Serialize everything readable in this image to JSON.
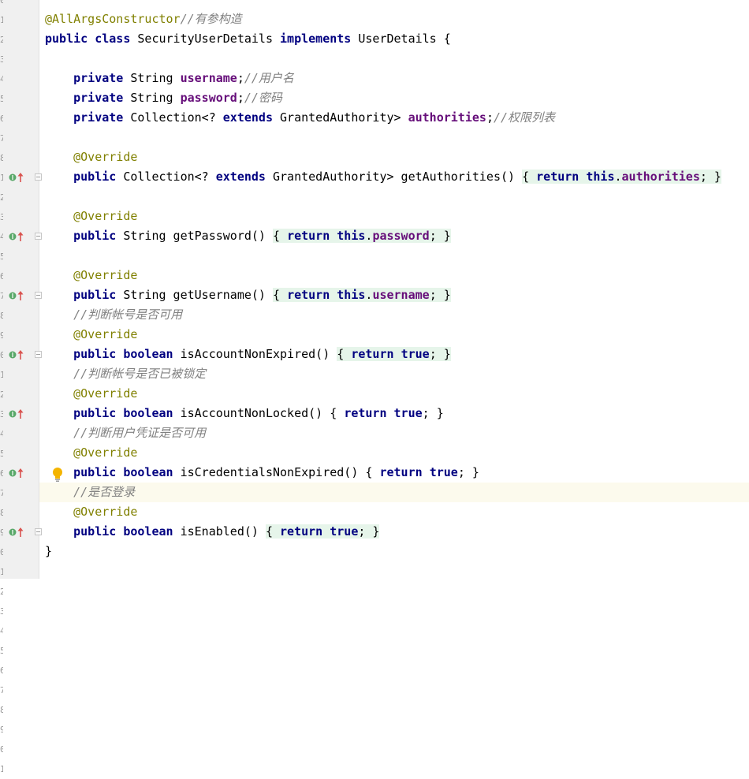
{
  "editor": {
    "line_numbers": [
      "0",
      "1",
      "2",
      "3",
      "4",
      "5",
      "6",
      "7",
      "8",
      "1",
      "2",
      "3",
      "4",
      "5",
      "6",
      "7",
      "8",
      "9",
      "0",
      "1",
      "2",
      "3",
      "4",
      "5",
      "6",
      "7",
      "8",
      "9",
      "0",
      "1",
      "2",
      "3",
      "4",
      "5",
      "6",
      "7",
      "8",
      "9",
      "0",
      "1"
    ],
    "lines": [
      [
        {
          "t": "@AllArgsConstructor",
          "c": "ann"
        },
        {
          "t": "//有参构造",
          "c": "cmt"
        }
      ],
      [
        {
          "t": "public",
          "c": "kw"
        },
        {
          "t": " "
        },
        {
          "t": "class",
          "c": "kw"
        },
        {
          "t": " SecurityUserDetails "
        },
        {
          "t": "implements",
          "c": "kw"
        },
        {
          "t": " UserDetails {"
        }
      ],
      [],
      [
        {
          "t": "    "
        },
        {
          "t": "private",
          "c": "kw"
        },
        {
          "t": " String "
        },
        {
          "t": "username",
          "c": "fld"
        },
        {
          "t": ";"
        },
        {
          "t": "//用户名",
          "c": "cmt"
        }
      ],
      [
        {
          "t": "    "
        },
        {
          "t": "private",
          "c": "kw"
        },
        {
          "t": " String "
        },
        {
          "t": "password",
          "c": "fld"
        },
        {
          "t": ";"
        },
        {
          "t": "//密码",
          "c": "cmt"
        }
      ],
      [
        {
          "t": "    "
        },
        {
          "t": "private",
          "c": "kw"
        },
        {
          "t": " Collection<? "
        },
        {
          "t": "extends",
          "c": "kw"
        },
        {
          "t": " GrantedAuthority> "
        },
        {
          "t": "authorities",
          "c": "fld"
        },
        {
          "t": ";"
        },
        {
          "t": "//权限列表",
          "c": "cmt"
        }
      ],
      [],
      [
        {
          "t": "    "
        },
        {
          "t": "@Override",
          "c": "ann"
        }
      ],
      [
        {
          "t": "    "
        },
        {
          "t": "public",
          "c": "kw"
        },
        {
          "t": " Collection<? "
        },
        {
          "t": "extends",
          "c": "kw"
        },
        {
          "t": " GrantedAuthority> getAuthorities() "
        },
        {
          "t": "{ ",
          "c": "fold"
        },
        {
          "t": "return",
          "c": "kw fold"
        },
        {
          "t": " ",
          "c": "fold"
        },
        {
          "t": "this",
          "c": "kw fold"
        },
        {
          "t": ".",
          "c": "fold"
        },
        {
          "t": "authorities",
          "c": "fld fold"
        },
        {
          "t": "; }",
          "c": "fold"
        }
      ],
      [],
      [
        {
          "t": "    "
        },
        {
          "t": "@Override",
          "c": "ann"
        }
      ],
      [
        {
          "t": "    "
        },
        {
          "t": "public",
          "c": "kw"
        },
        {
          "t": " String getPassword() "
        },
        {
          "t": "{ ",
          "c": "fold"
        },
        {
          "t": "return",
          "c": "kw fold"
        },
        {
          "t": " ",
          "c": "fold"
        },
        {
          "t": "this",
          "c": "kw fold"
        },
        {
          "t": ".",
          "c": "fold"
        },
        {
          "t": "password",
          "c": "fld fold"
        },
        {
          "t": "; }",
          "c": "fold"
        }
      ],
      [],
      [
        {
          "t": "    "
        },
        {
          "t": "@Override",
          "c": "ann"
        }
      ],
      [
        {
          "t": "    "
        },
        {
          "t": "public",
          "c": "kw"
        },
        {
          "t": " String getUsername() "
        },
        {
          "t": "{ ",
          "c": "fold"
        },
        {
          "t": "return",
          "c": "kw fold"
        },
        {
          "t": " ",
          "c": "fold"
        },
        {
          "t": "this",
          "c": "kw fold"
        },
        {
          "t": ".",
          "c": "fold"
        },
        {
          "t": "username",
          "c": "fld fold"
        },
        {
          "t": "; }",
          "c": "fold"
        }
      ],
      [
        {
          "t": "    "
        },
        {
          "t": "//判断帐号是否可用",
          "c": "cmt"
        }
      ],
      [
        {
          "t": "    "
        },
        {
          "t": "@Override",
          "c": "ann"
        }
      ],
      [
        {
          "t": "    "
        },
        {
          "t": "public",
          "c": "kw"
        },
        {
          "t": " "
        },
        {
          "t": "boolean",
          "c": "kw"
        },
        {
          "t": " isAccountNonExpired() "
        },
        {
          "t": "{ ",
          "c": "fold"
        },
        {
          "t": "return",
          "c": "kw fold"
        },
        {
          "t": " ",
          "c": "fold"
        },
        {
          "t": "true",
          "c": "kw fold"
        },
        {
          "t": "; }",
          "c": "fold"
        }
      ],
      [
        {
          "t": "    "
        },
        {
          "t": "//判断帐号是否已被锁定",
          "c": "cmt"
        }
      ],
      [
        {
          "t": "    "
        },
        {
          "t": "@Override",
          "c": "ann"
        }
      ],
      [
        {
          "t": "    "
        },
        {
          "t": "public",
          "c": "kw"
        },
        {
          "t": " "
        },
        {
          "t": "boolean",
          "c": "kw"
        },
        {
          "t": " isAccountNonLocked() { "
        },
        {
          "t": "return",
          "c": "kw"
        },
        {
          "t": " "
        },
        {
          "t": "true",
          "c": "kw"
        },
        {
          "t": "; }"
        }
      ],
      [
        {
          "t": "    "
        },
        {
          "t": "//判断用户凭证是否可用",
          "c": "cmt"
        }
      ],
      [
        {
          "t": "    "
        },
        {
          "t": "@Override",
          "c": "ann"
        }
      ],
      [
        {
          "t": "    "
        },
        {
          "t": "public",
          "c": "kw"
        },
        {
          "t": " "
        },
        {
          "t": "boolean",
          "c": "kw"
        },
        {
          "t": " isCredentialsNonExpired() { "
        },
        {
          "t": "return",
          "c": "kw"
        },
        {
          "t": " "
        },
        {
          "t": "true",
          "c": "kw"
        },
        {
          "t": "; }"
        }
      ],
      [
        {
          "t": "    "
        },
        {
          "t": "//是否登录",
          "c": "cmt"
        }
      ],
      [
        {
          "t": "    "
        },
        {
          "t": "@Override",
          "c": "ann"
        }
      ],
      [
        {
          "t": "    "
        },
        {
          "t": "public",
          "c": "kw"
        },
        {
          "t": " "
        },
        {
          "t": "boolean",
          "c": "kw"
        },
        {
          "t": " isEnabled() "
        },
        {
          "t": "{ ",
          "c": "fold"
        },
        {
          "t": "return",
          "c": "kw fold"
        },
        {
          "t": " ",
          "c": "fold"
        },
        {
          "t": "true",
          "c": "kw fold"
        },
        {
          "t": "; }",
          "c": "fold"
        }
      ],
      [
        {
          "t": "}"
        }
      ]
    ],
    "override_icon_lines": [
      8,
      11,
      14,
      17,
      20,
      23,
      26
    ],
    "fold_marker_lines": [
      8,
      11,
      14,
      17,
      26
    ],
    "intention_bulb_line": 23,
    "caret_line": 24,
    "colors": {
      "keyword": "#000080",
      "field": "#660e7a",
      "annotation": "#808000",
      "comment": "#808080",
      "fold_background": "#e6f5ea",
      "caret_row": "#fcfaed",
      "gutter": "#f0f0f0"
    },
    "icons": [
      "override-method-icon",
      "fold-marker-icon",
      "intention-bulb-icon"
    ]
  }
}
